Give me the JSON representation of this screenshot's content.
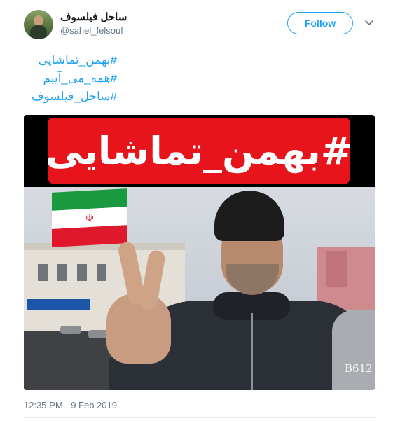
{
  "user": {
    "display_name": "ساحل فیلسوف",
    "handle": "@sahel_felsouf",
    "follow_label": "Follow"
  },
  "tweet": {
    "hashtags": [
      "#بهمن_تماشایی",
      "#همه_می_آییم",
      "#ساحل_فیلسوف"
    ],
    "timestamp": "12:35 PM - 9 Feb 2019"
  },
  "media": {
    "banner_text": "#بهمن_تماشایی",
    "watermark_text": "B612"
  },
  "colors": {
    "accent": "#1da1f2",
    "banner_red": "#e8141c"
  },
  "icons": {
    "menu": "chevron-down-icon"
  }
}
